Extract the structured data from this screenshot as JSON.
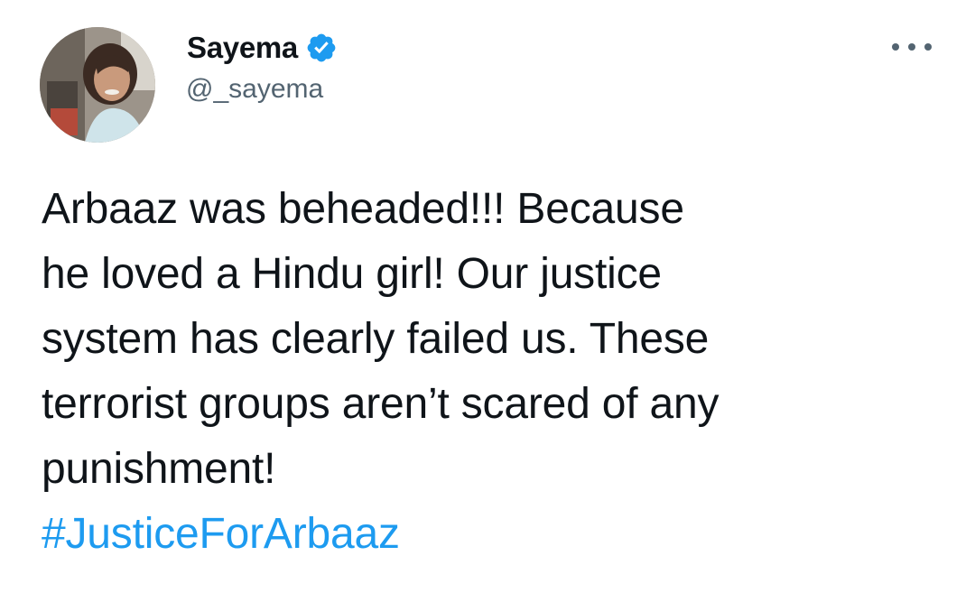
{
  "tweet": {
    "author": {
      "display_name": "Sayema",
      "handle": "@_sayema",
      "verified_icon": "verified-badge-icon",
      "avatar_icon": "profile-photo"
    },
    "more_icon": "more-options-icon",
    "text_lines": [
      "Arbaaz was beheaded!!! Because",
      "he loved a Hindu girl! Our justice",
      "system has clearly failed us. These",
      "terrorist groups aren’t scared of any",
      "punishment!"
    ],
    "hashtag": "#JusticeForArbaaz"
  },
  "colors": {
    "text": "#0f1419",
    "secondary": "#536471",
    "accent": "#1d9bf0"
  }
}
